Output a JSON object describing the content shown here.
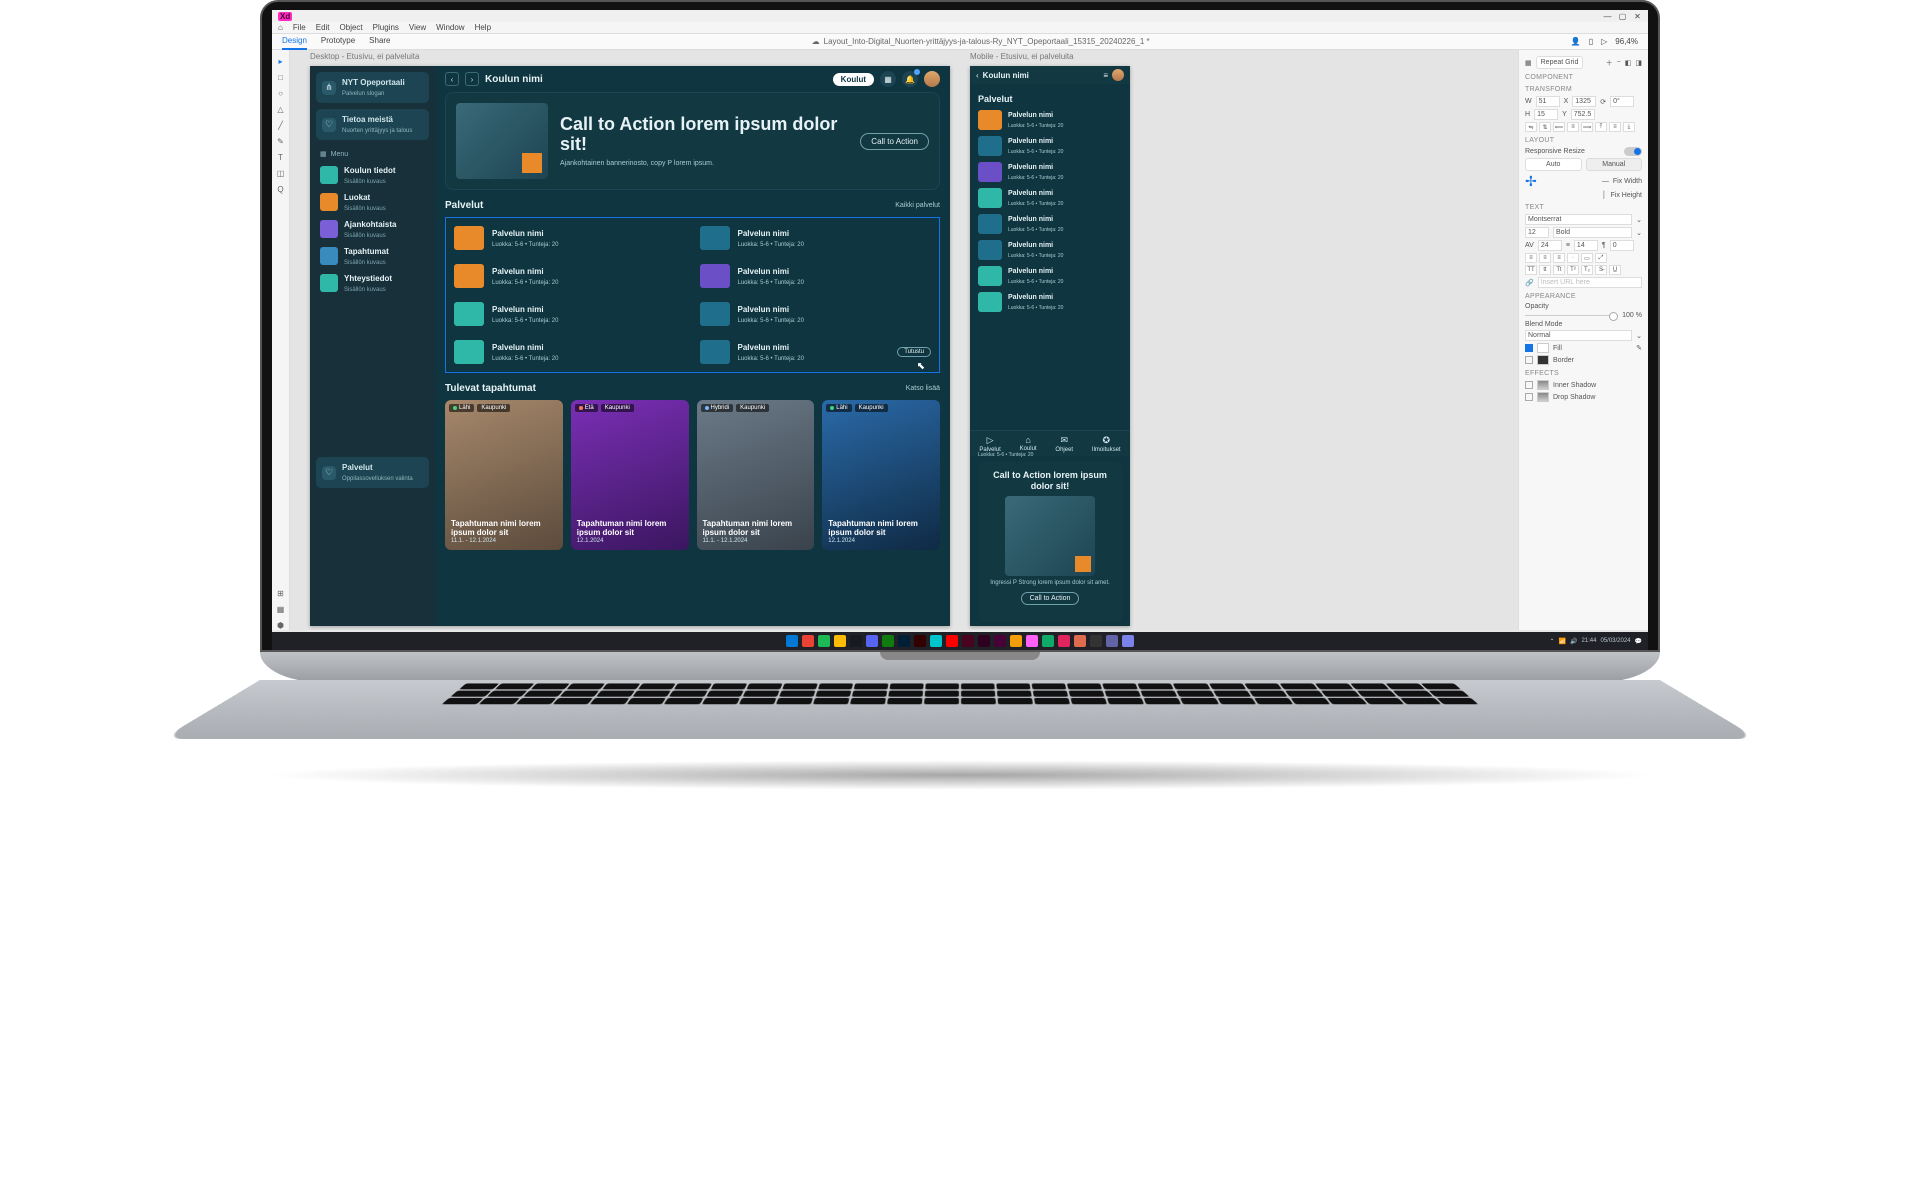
{
  "app": {
    "icon": "Xd"
  },
  "menubar": [
    "File",
    "Edit",
    "Object",
    "Plugins",
    "View",
    "Window",
    "Help"
  ],
  "docbar": {
    "tabs": [
      "Design",
      "Prototype",
      "Share"
    ],
    "filename": "Layout_Into-Digital_Nuorten-yrittäjyys-ja-talous-Ry_NYT_Opeportaali_15315_20240226_1 *",
    "zoom": "96,4%"
  },
  "tools": [
    "▸",
    "□",
    "○",
    "△",
    "╱",
    "✎",
    "T",
    "◫",
    "Q"
  ],
  "tools_bottom": [
    "⊞",
    "▦",
    "⬢"
  ],
  "right_panel": {
    "repeat_grid": "Repeat Grid",
    "component_label": "COMPONENT",
    "transform_label": "TRANSFORM",
    "w": "W",
    "w_val": "51",
    "x": "X",
    "x_val": "1325",
    "rot": "0°",
    "h": "H",
    "h_val": "15",
    "y": "Y",
    "y_val": "752.5",
    "layout_label": "LAYOUT",
    "responsive": "Responsive Resize",
    "mode_auto": "Auto",
    "mode_manual": "Manual",
    "fix_w": "Fix Width",
    "fix_h": "Fix Height",
    "text_label": "TEXT",
    "font": "Montserrat",
    "size": "12",
    "weight": "Bold",
    "char": "24",
    "line": "14",
    "para": "0",
    "link_label": "Insert URL here",
    "appearance_label": "APPEARANCE",
    "opacity_label": "Opacity",
    "opacity_val": "100 %",
    "blend_label": "Blend Mode",
    "blend_val": "Normal",
    "fill": "Fill",
    "border": "Border",
    "effects_label": "EFFECTS",
    "inner_shadow": "Inner Shadow",
    "drop_shadow": "Drop Shadow"
  },
  "artboards": {
    "desktop_label": "Desktop - Etusivu, ei palveluita",
    "mobile_label": "Mobile - Etusivu, ei palveluita"
  },
  "sidebar": {
    "brand": {
      "title": "NYT Opeportaali",
      "sub": "Palvelun slogan"
    },
    "about": {
      "title": "Tietoa meistä",
      "sub": "Nuorten yrittäjyys ja talous"
    },
    "menu_label": "Menu",
    "items": [
      {
        "title": "Koulun tiedot",
        "sub": "Sisällön kuvaus",
        "color": "#2fb7a8"
      },
      {
        "title": "Luokat",
        "sub": "Sisällön kuvaus",
        "color": "#e88a2a"
      },
      {
        "title": "Ajankohtaista",
        "sub": "Sisällön kuvaus",
        "color": "#7a5fd6"
      },
      {
        "title": "Tapahtumat",
        "sub": "Sisällön kuvaus",
        "color": "#3a8bbd"
      },
      {
        "title": "Yhteystiedot",
        "sub": "Sisällön kuvaus",
        "color": "#2fb7a8"
      }
    ],
    "bottom": {
      "title": "Palvelut",
      "sub": "Oppilassovelluksen valinta"
    }
  },
  "header": {
    "title": "Koulun nimi",
    "pill": "Koulut"
  },
  "hero": {
    "title": "Call to Action lorem ipsum dolor sit!",
    "sub": "Ajankohtainen bannerinosto, copy P lorem ipsum.",
    "cta": "Call to Action"
  },
  "services": {
    "title": "Palvelut",
    "all": "Kaikki palvelut",
    "items": [
      {
        "name": "Palvelun nimi",
        "meta": "Luokka: 5-6 • Tunteja: 20",
        "c": "#e88a2a"
      },
      {
        "name": "Palvelun nimi",
        "meta": "Luokka: 5-6 • Tunteja: 20",
        "c": "#1f6e8c"
      },
      {
        "name": "Palvelun nimi",
        "meta": "Luokka: 5-6 • Tunteja: 20",
        "c": "#e88a2a"
      },
      {
        "name": "Palvelun nimi",
        "meta": "Luokka: 5-6 • Tunteja: 20",
        "c": "#6b4fc6"
      },
      {
        "name": "Palvelun nimi",
        "meta": "Luokka: 5-6 • Tunteja: 20",
        "c": "#2fb7a8"
      },
      {
        "name": "Palvelun nimi",
        "meta": "Luokka: 5-6 • Tunteja: 20",
        "c": "#1f6e8c"
      },
      {
        "name": "Palvelun nimi",
        "meta": "Luokka: 5-6 • Tunteja: 20",
        "c": "#2fb7a8"
      },
      {
        "name": "Palvelun nimi",
        "meta": "Luokka: 5-6 • Tunteja: 20",
        "c": "#1f6e8c",
        "go": "Tutustu"
      }
    ]
  },
  "events": {
    "title": "Tulevat tapahtumat",
    "more": "Katso lisää",
    "items": [
      {
        "tag1": "Lähi",
        "tag2": "Kaupunki",
        "d": "#3fd67a",
        "name": "Tapahtuman nimi lorem ipsum dolor sit",
        "date": "11.1. - 12.1.2024",
        "bg": "linear-gradient(160deg,#a6886b,#5c4b3c)"
      },
      {
        "tag1": "Etä",
        "tag2": "Kaupunki",
        "d": "#ff7b4f",
        "name": "Tapahtuman nimi lorem ipsum dolor sit",
        "date": "12.1.2024",
        "bg": "linear-gradient(160deg,#7a2fb5,#3b1660)"
      },
      {
        "tag1": "Hybridi",
        "tag2": "Kaupunki",
        "d": "#7bb6ff",
        "name": "Tapahtuman nimi lorem ipsum dolor sit",
        "date": "11.1. - 12.1.2024",
        "bg": "linear-gradient(160deg,#6b7a88,#3a434c)"
      },
      {
        "tag1": "Lähi",
        "tag2": "Kaupunki",
        "d": "#3fd67a",
        "name": "Tapahtuman nimi lorem ipsum dolor sit",
        "date": "12.1.2024",
        "bg": "linear-gradient(160deg,#2a6aa8,#0f2a44)"
      }
    ]
  },
  "mobile": {
    "header": "Koulun nimi",
    "section": "Palvelut",
    "items": [
      {
        "name": "Palvelun nimi",
        "meta": "Luokka: 5-6 • Tunteja: 20",
        "c": "#e88a2a"
      },
      {
        "name": "Palvelun nimi",
        "meta": "Luokka: 5-6 • Tunteja: 20",
        "c": "#1f6e8c"
      },
      {
        "name": "Palvelun nimi",
        "meta": "Luokka: 5-6 • Tunteja: 20",
        "c": "#6b4fc6"
      },
      {
        "name": "Palvelun nimi",
        "meta": "Luokka: 5-6 • Tunteja: 20",
        "c": "#2fb7a8"
      },
      {
        "name": "Palvelun nimi",
        "meta": "Luokka: 5-6 • Tunteja: 20",
        "c": "#1f6e8c"
      },
      {
        "name": "Palvelun nimi",
        "meta": "Luokka: 5-6 • Tunteja: 20",
        "c": "#1f6e8c"
      },
      {
        "name": "Palvelun nimi",
        "meta": "Luokka: 5-6 • Tunteja: 20",
        "c": "#2fb7a8"
      },
      {
        "name": "Palvelun nimi",
        "meta": "Luokka: 5-6 • Tunteja: 20",
        "c": "#2fb7a8"
      }
    ],
    "extra_meta": "Luokka: 5-6 • Tunteja: 20",
    "nav": [
      {
        "ic": "▷",
        "l": "Palvelut"
      },
      {
        "ic": "⌂",
        "l": "Koulut"
      },
      {
        "ic": "✉",
        "l": "Ohjeet"
      },
      {
        "ic": "✪",
        "l": "Ilmoitukset"
      }
    ],
    "hero_title": "Call to Action lorem ipsum dolor sit!",
    "hero_sub": "Ingressi P Strong lorem ipsum dolor sit amet.",
    "hero_cta": "Call to Action"
  },
  "taskbar": {
    "apps": [
      "#0078d4",
      "#ea4335",
      "#1db954",
      "#fbbc05",
      "#171a21",
      "#5865f2",
      "#107c10",
      "#001e36",
      "#330000",
      "#00c4cc",
      "#ff0000",
      "#49021f",
      "#2d001f",
      "#470137",
      "#f59e0b",
      "#ff61f6",
      "#0fa968",
      "#e0245e",
      "#df6c4f",
      "#333333",
      "#6264a7",
      "#7b83eb"
    ],
    "time": "21:44",
    "date": "05/03/2024"
  }
}
